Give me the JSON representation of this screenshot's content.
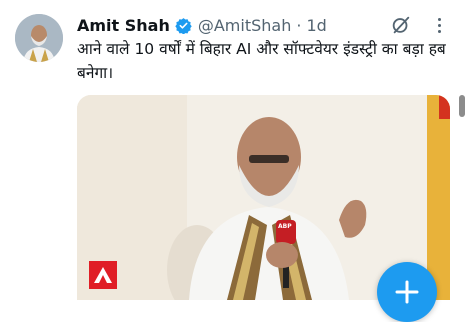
{
  "tweet": {
    "author_name": "Amit Shah",
    "handle": "@AmitShah",
    "separator": "·",
    "time": "1d",
    "text": "आने वाले 10 वर्षों में बिहार AI और सॉफ्टवेयर इंडस्ट्री का बड़ा हब बनेगा।",
    "verified_icon": "verified-badge-icon",
    "verified_color": "#1d9bf0",
    "more_icon": "more-dots-icon",
    "grok_icon": "grok-icon"
  },
  "media": {
    "type": "video-still",
    "logo_icon": "abp-news-logo-icon",
    "microphone_label": "ABP"
  },
  "compose": {
    "icon": "compose-plus-icon",
    "color": "#1d9bf0"
  }
}
